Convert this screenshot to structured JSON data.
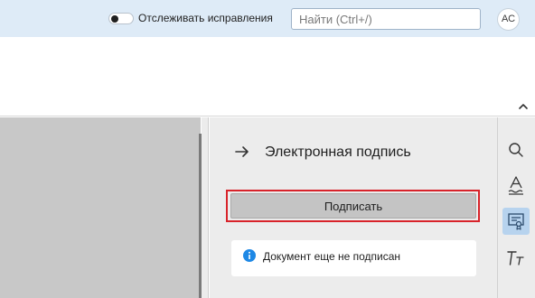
{
  "topbar": {
    "track_changes_label": "Отслеживать исправления",
    "track_changes_on": false,
    "search_placeholder": "Найти (Ctrl+/)",
    "avatar_initials": "АС"
  },
  "panel": {
    "title": "Электронная подпись",
    "sign_button_label": "Подписать",
    "status_text": "Документ еще не подписан"
  },
  "icons": {
    "collapse": "chevron-up-icon",
    "back": "arrow-right-icon",
    "info": "info-icon",
    "rail": [
      "search-icon",
      "spellcheck-icon",
      "signature-icon",
      "text-style-icon"
    ]
  },
  "colors": {
    "accent": "#1e88e5",
    "highlight_border": "#d8232a",
    "active_rail": "#b7d3ee",
    "topbar_bg": "#deebf7"
  }
}
